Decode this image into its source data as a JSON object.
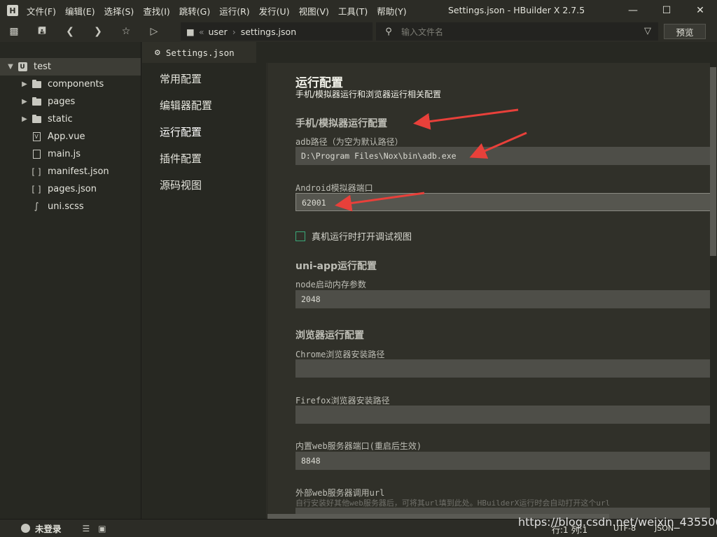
{
  "app": {
    "logo_letter": "H",
    "title": "Settings.json - HBuilder X 2.7.5"
  },
  "menu": [
    "文件(F)",
    "编辑(E)",
    "选择(S)",
    "查找(I)",
    "跳转(G)",
    "运行(R)",
    "发行(U)",
    "视图(V)",
    "工具(T)",
    "帮助(Y)"
  ],
  "toolbar": {
    "breadcrumb_prefix": "«",
    "breadcrumb": [
      "user",
      "settings.json"
    ],
    "breadcrumb_sep": "›",
    "file_search_placeholder": "输入文件名",
    "preview_label": "预览"
  },
  "sidebar": {
    "project": {
      "name": "test",
      "icon": "uni-app-icon",
      "letter": "U"
    },
    "items": [
      {
        "name": "components",
        "icon": "folder-icon",
        "expandable": true
      },
      {
        "name": "pages",
        "icon": "folder-icon",
        "expandable": true
      },
      {
        "name": "static",
        "icon": "folder-icon",
        "expandable": true
      },
      {
        "name": "App.vue",
        "icon": "vue-file-icon",
        "expandable": false
      },
      {
        "name": "main.js",
        "icon": "js-file-icon",
        "expandable": false
      },
      {
        "name": "manifest.json",
        "icon": "json-file-icon",
        "expandable": false
      },
      {
        "name": "pages.json",
        "icon": "json-file-icon",
        "expandable": false
      },
      {
        "name": "uni.scss",
        "icon": "scss-file-icon",
        "expandable": false
      }
    ]
  },
  "tab": {
    "label": "Settings.json"
  },
  "config_nav": [
    "常用配置",
    "编辑器配置",
    "运行配置",
    "插件配置",
    "源码视图"
  ],
  "config_nav_active": "运行配置",
  "main": {
    "title": "运行配置",
    "subtitle": "手机/模拟器运行和浏览器运行相关配置",
    "phone_section": "手机/模拟器运行配置",
    "adb_label": "adb路径（为空为默认路径）",
    "adb_value": "D:\\Program Files\\Nox\\bin\\adb.exe",
    "emu_port_label": "Android模拟器端口",
    "emu_port_value": "62001",
    "debug_view_label": "真机运行时打开调试视图",
    "uniapp_section": "uni-app运行配置",
    "node_mem_label": "node启动内存参数",
    "node_mem_value": "2048",
    "browser_section": "浏览器运行配置",
    "chrome_label": "Chrome浏览器安装路径",
    "chrome_value": "",
    "firefox_label": "Firefox浏览器安装路径",
    "firefox_value": "",
    "webport_label": "内置web服务器端口(重启后生效)",
    "webport_value": "8848",
    "exturl_label": "外部web服务器调用url",
    "exturl_hint": "自行安装好其他web服务器后，可将其url填到此处。HBuilderX运行时会自动打开这个url"
  },
  "statusbar": {
    "login": "未登录",
    "position": "行:1  列:1",
    "encoding": "UTF-8",
    "filetype": "JSON"
  },
  "watermark": "https://blog.csdn.net/weixin_43550660",
  "colors": {
    "annotation_arrow": "#e8403a",
    "checkbox_border": "#3aa878"
  }
}
